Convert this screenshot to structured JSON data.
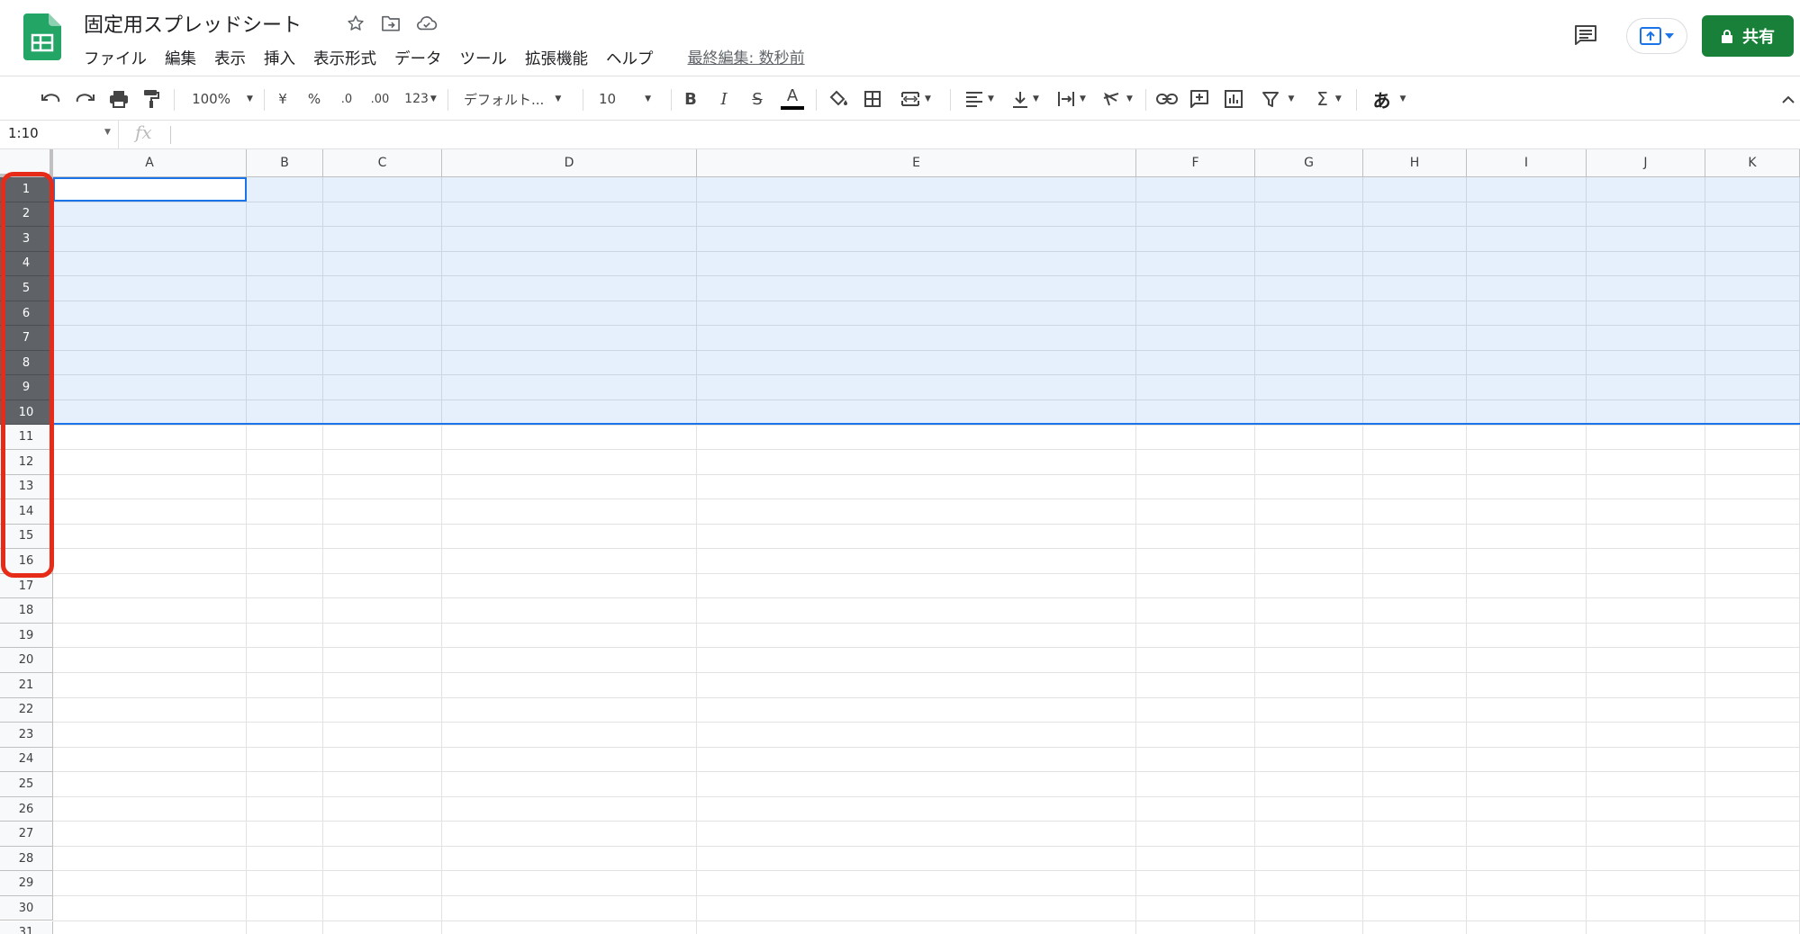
{
  "doc": {
    "title": "固定用スプレッドシート"
  },
  "menu": [
    "ファイル",
    "編集",
    "表示",
    "挿入",
    "表示形式",
    "データ",
    "ツール",
    "拡張機能",
    "ヘルプ"
  ],
  "last_edit": "最終編集: 数秒前",
  "share_label": "共有",
  "toolbar": {
    "zoom": "100%",
    "currency": "¥",
    "percent": "%",
    "dec_decrease": ".0",
    "dec_increase": ".00",
    "number_format": "123",
    "font": "デフォルト...",
    "font_size": "10",
    "bold": "B",
    "italic": "I",
    "strike": "S",
    "text_color": "A",
    "input_tools": "あ",
    "sum": "Σ"
  },
  "formula_bar": {
    "name_box": "1:10",
    "fx": "fx"
  },
  "grid": {
    "columns": [
      "A",
      "B",
      "C",
      "D",
      "E",
      "F",
      "G",
      "H",
      "I",
      "J",
      "K"
    ],
    "rows": [
      "1",
      "2",
      "3",
      "4",
      "5",
      "6",
      "7",
      "8",
      "9",
      "10",
      "11",
      "12",
      "13",
      "14",
      "15",
      "16",
      "17",
      "18",
      "19",
      "20",
      "21",
      "22",
      "23",
      "24",
      "25",
      "26",
      "27",
      "28",
      "29",
      "30",
      "31"
    ]
  },
  "colors": {
    "brand_green": "#188038",
    "selection_blue": "#1a73e8",
    "highlight_red": "#e62c18"
  }
}
